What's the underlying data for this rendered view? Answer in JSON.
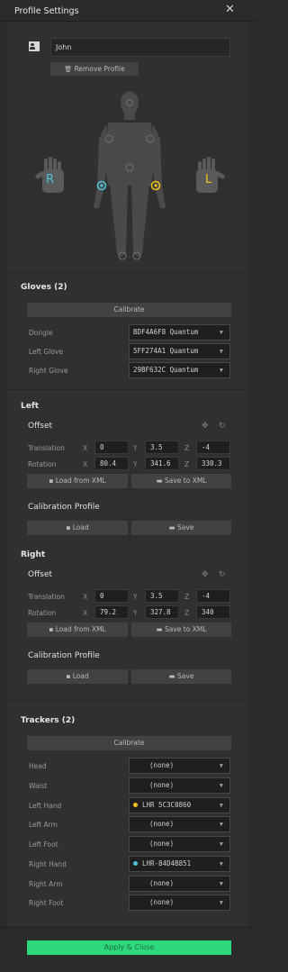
{
  "header": {
    "title": "Profile Settings",
    "close": "✕"
  },
  "profile": {
    "name": "John",
    "remove_label": "Remove Profile"
  },
  "body_diagram": {
    "right_glove": "R",
    "left_glove": "L",
    "accent_cyan": "#4fc3d9",
    "accent_yellow": "#f2c21b"
  },
  "gloves": {
    "title": "Gloves (2)",
    "calibrate": "Calibrate",
    "rows": [
      {
        "label": "Dongle",
        "value": "BDF4A6F8 Quantum"
      },
      {
        "label": "Left Glove",
        "value": "5FF274A1 Quantum"
      },
      {
        "label": "Right Glove",
        "value": "29BF632C Quantum"
      }
    ]
  },
  "left": {
    "title": "Left",
    "offset": "Offset",
    "translation": "Translation",
    "rotation": "Rotation",
    "tx": "0",
    "ty": "3.5",
    "tz": "-4",
    "rx": "80.4",
    "ry": "341.6",
    "rz": "330.3",
    "load_xml": "Load from XML",
    "save_xml": "Save to XML",
    "calib": "Calibration Profile",
    "load": "Load",
    "save": "Save"
  },
  "right": {
    "title": "Right",
    "offset": "Offset",
    "translation": "Translation",
    "rotation": "Rotation",
    "tx": "0",
    "ty": "3.5",
    "tz": "-4",
    "rx": "79.2",
    "ry": "327.8",
    "rz": "340",
    "load_xml": "Load from XML",
    "save_xml": "Save to XML",
    "calib": "Calibration Profile",
    "load": "Load",
    "save": "Save"
  },
  "axes": {
    "x": "X",
    "y": "Y",
    "z": "Z"
  },
  "trackers": {
    "title": "Trackers (2)",
    "calibrate": "Calibrate",
    "rows": [
      {
        "label": "Head",
        "value": "(none)"
      },
      {
        "label": "Waist",
        "value": "(none)"
      },
      {
        "label": "Left Hand",
        "value": "LHR 5C3C0860",
        "dot": "#f2c21b"
      },
      {
        "label": "Left Arm",
        "value": "(none)"
      },
      {
        "label": "Left Foot",
        "value": "(none)"
      },
      {
        "label": "Right Hand",
        "value": "LHR-84D4B851",
        "dot": "#4fc3d9"
      },
      {
        "label": "Right Arm",
        "value": "(none)"
      },
      {
        "label": "Right Foot",
        "value": "(none)"
      }
    ]
  },
  "apply": "Apply & Close"
}
